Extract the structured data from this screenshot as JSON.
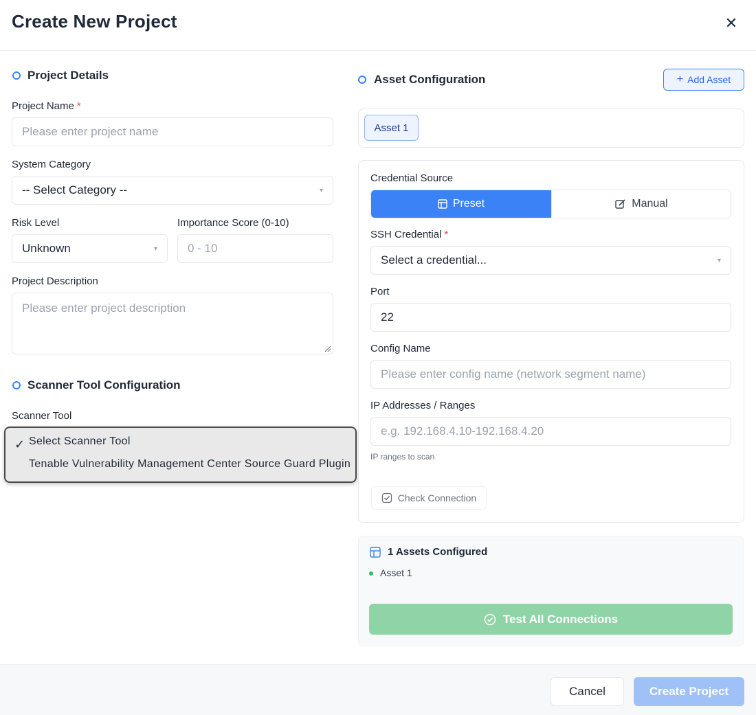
{
  "dialog": {
    "title": "Create New Project",
    "close_icon": "close-icon"
  },
  "project_details": {
    "section_title": "Project Details",
    "project_name_label": "Project Name",
    "required_mark": "*",
    "project_name_placeholder": "Please enter project name",
    "system_category_label": "System Category",
    "system_category_value": "-- Select Category --",
    "risk_level_label": "Risk Level",
    "risk_level_value": "Unknown",
    "importance_label": "Importance Score (0-10)",
    "importance_placeholder": "0 - 10",
    "description_label": "Project Description",
    "description_placeholder": "Please enter project description"
  },
  "scanner": {
    "section_title": "Scanner Tool Configuration",
    "tool_label": "Scanner Tool",
    "options": [
      {
        "label": "Select Scanner Tool",
        "selected": true
      },
      {
        "label": "Tenable Vulnerability Management Center Source Guard Plugin",
        "selected": false
      }
    ]
  },
  "asset_config": {
    "section_title": "Asset Configuration",
    "add_asset_label": "Add Asset",
    "tabs": [
      "Asset 1"
    ],
    "credential_source_label": "Credential Source",
    "preset_label": "Preset",
    "manual_label": "Manual",
    "ssh_label": "SSH Credential",
    "required_mark": "*",
    "ssh_value": "Select a credential...",
    "port_label": "Port",
    "port_value": "22",
    "config_name_label": "Config Name",
    "config_name_placeholder": "Please enter config name (network segment name)",
    "ip_label": "IP Addresses / Ranges",
    "ip_placeholder": "e.g. 192.168.4.10-192.168.4.20",
    "ip_hint": "IP ranges to scan",
    "check_connection_label": "Check Connection"
  },
  "summary": {
    "title": "1 Assets Configured",
    "items": [
      "Asset 1"
    ],
    "test_all_label": "Test All Connections"
  },
  "footer": {
    "cancel_label": "Cancel",
    "create_label": "Create Project"
  },
  "colors": {
    "accent": "#3b82f6",
    "required": "#ef4444",
    "success_disabled": "#8fd4a6",
    "primary_disabled": "#9fc1f7"
  }
}
